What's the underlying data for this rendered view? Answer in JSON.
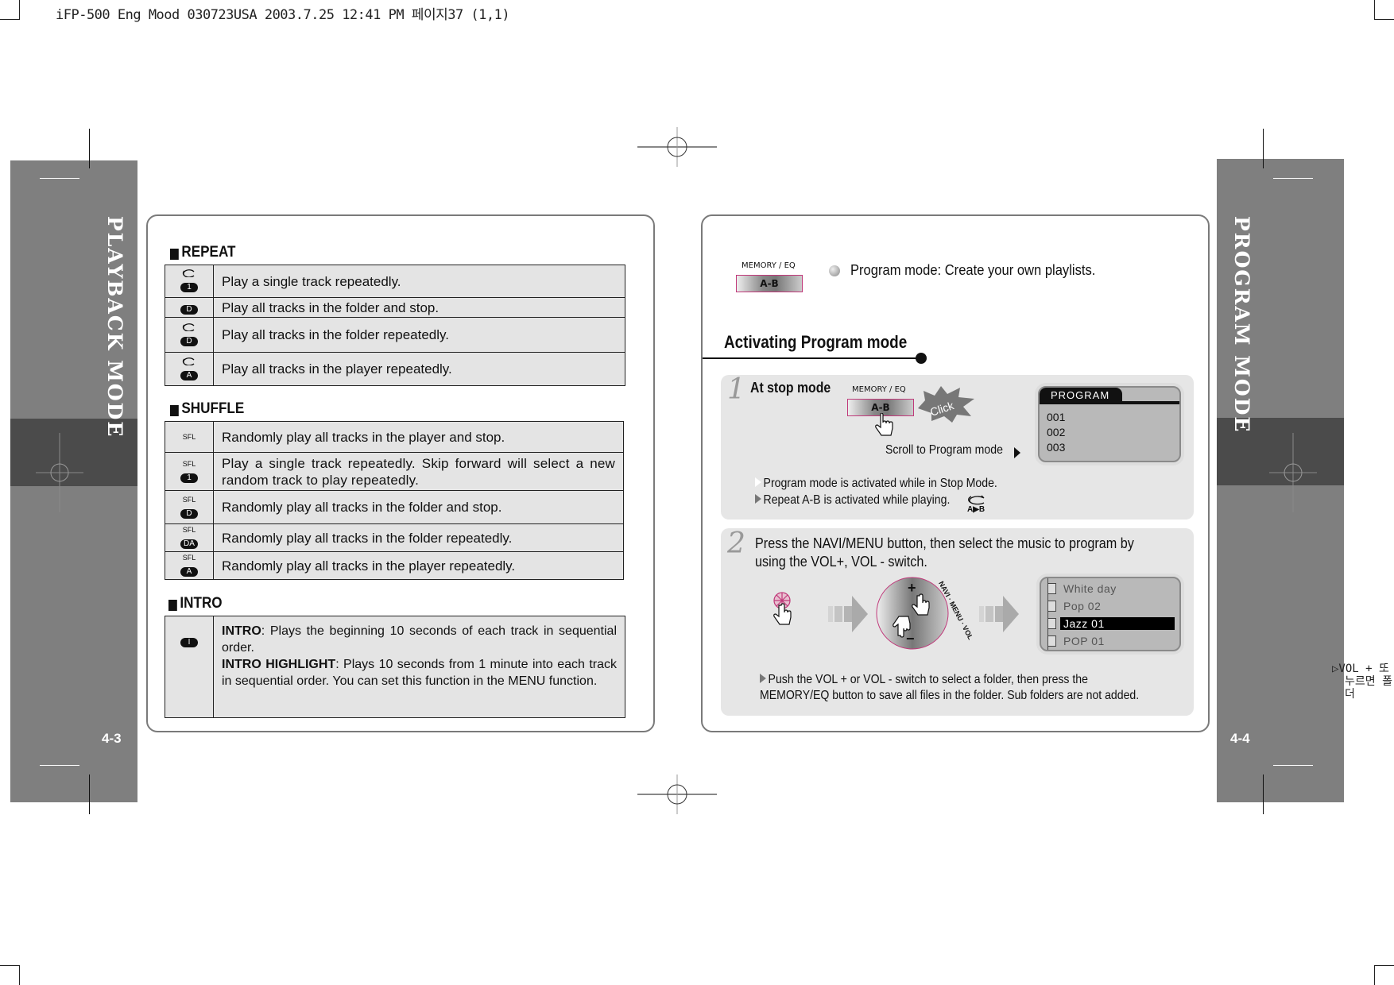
{
  "print_header": "iFP-500 Eng Mood 030723USA  2003.7.25 12:41 PM 페이지37 (1,1)",
  "left_page": {
    "tab_title": "PLAYBACK MODE",
    "page_number": "4-3",
    "repeat": {
      "heading": "REPEAT",
      "rows": [
        {
          "icon": "repeat-1",
          "badge": "1",
          "has_loop": true,
          "text": "Play a single track repeatedly."
        },
        {
          "icon": "repeat-d-stop",
          "badge": "D",
          "has_loop": false,
          "text": "Play all tracks in the folder and stop."
        },
        {
          "icon": "repeat-d",
          "badge": "D",
          "has_loop": true,
          "text": "Play all tracks in the folder repeatedly."
        },
        {
          "icon": "repeat-a",
          "badge": "A",
          "has_loop": true,
          "text": "Play all tracks in the player repeatedly."
        }
      ]
    },
    "shuffle": {
      "heading": "SHUFFLE",
      "rows": [
        {
          "sfl": "SFL",
          "badge": "",
          "text": "Randomly play all tracks in the player and stop."
        },
        {
          "sfl": "SFL",
          "badge": "1",
          "text": "Play a single track repeatedly. Skip forward will select a new random track to play repeatedly."
        },
        {
          "sfl": "SFL",
          "badge": "D",
          "text": "Randomly play all tracks in the folder and stop."
        },
        {
          "sfl": "SFL",
          "badge": "DA",
          "text": "Randomly play all tracks in the folder repeatedly."
        },
        {
          "sfl": "SFL",
          "badge": "A",
          "text": "Randomly play all tracks in the player repeatedly."
        }
      ]
    },
    "intro": {
      "heading": "INTRO",
      "badge": "I",
      "intro_label": "INTRO",
      "intro_text": ": Plays the beginning 10 seconds of each track in sequential order.",
      "highlight_label": "INTRO HIGHLIGHT",
      "highlight_text": ": Plays 10 seconds from 1 minute into each track in sequential order. You can set this function in the MENU function."
    }
  },
  "right_page": {
    "tab_title": "PROGRAM MODE",
    "page_number": "4-4",
    "intro": {
      "button_top_label": "MEMORY / EQ",
      "button_label": "A-B",
      "description": "Program mode: Create your own playlists."
    },
    "section_title": "Activating Program mode",
    "step1": {
      "number": "1",
      "title": "At stop mode",
      "button_top_label": "MEMORY / EQ",
      "button_label": "A-B",
      "click_label": "Click",
      "scroll_label": "Scroll to Program mode",
      "lcd": {
        "header": "PROGRAM",
        "items": [
          "001",
          "002",
          "003"
        ]
      },
      "notes": [
        "Program mode is activated while in Stop Mode.",
        "Repeat A-B is activated while playing."
      ],
      "ab_icon_label": "A▶B"
    },
    "step2": {
      "number": "2",
      "instruction": "Press the NAVI/MENU button, then select the music to program by using the VOL+, VOL - switch.",
      "dial_label": "NAVI · MENU · VOL",
      "dial_plus": "+",
      "dial_minus": "−",
      "list": {
        "items": [
          "White day",
          "Pop 02",
          "Jazz 01",
          "POP 01"
        ],
        "selected_index": 2
      },
      "note": "Push the VOL + or VOL - switch to select a folder, then press the MEMORY/EQ button to save all files in the folder. Sub folders are not added."
    },
    "margin_note": [
      "▷VOL + 또",
      "누르면 폴더"
    ]
  },
  "colors": {
    "tab_gray": "#7f7f7f",
    "tab_dark": "#4b4b4b",
    "cell_bg": "#e4e4e4",
    "accent_pink": "#c0397a"
  }
}
